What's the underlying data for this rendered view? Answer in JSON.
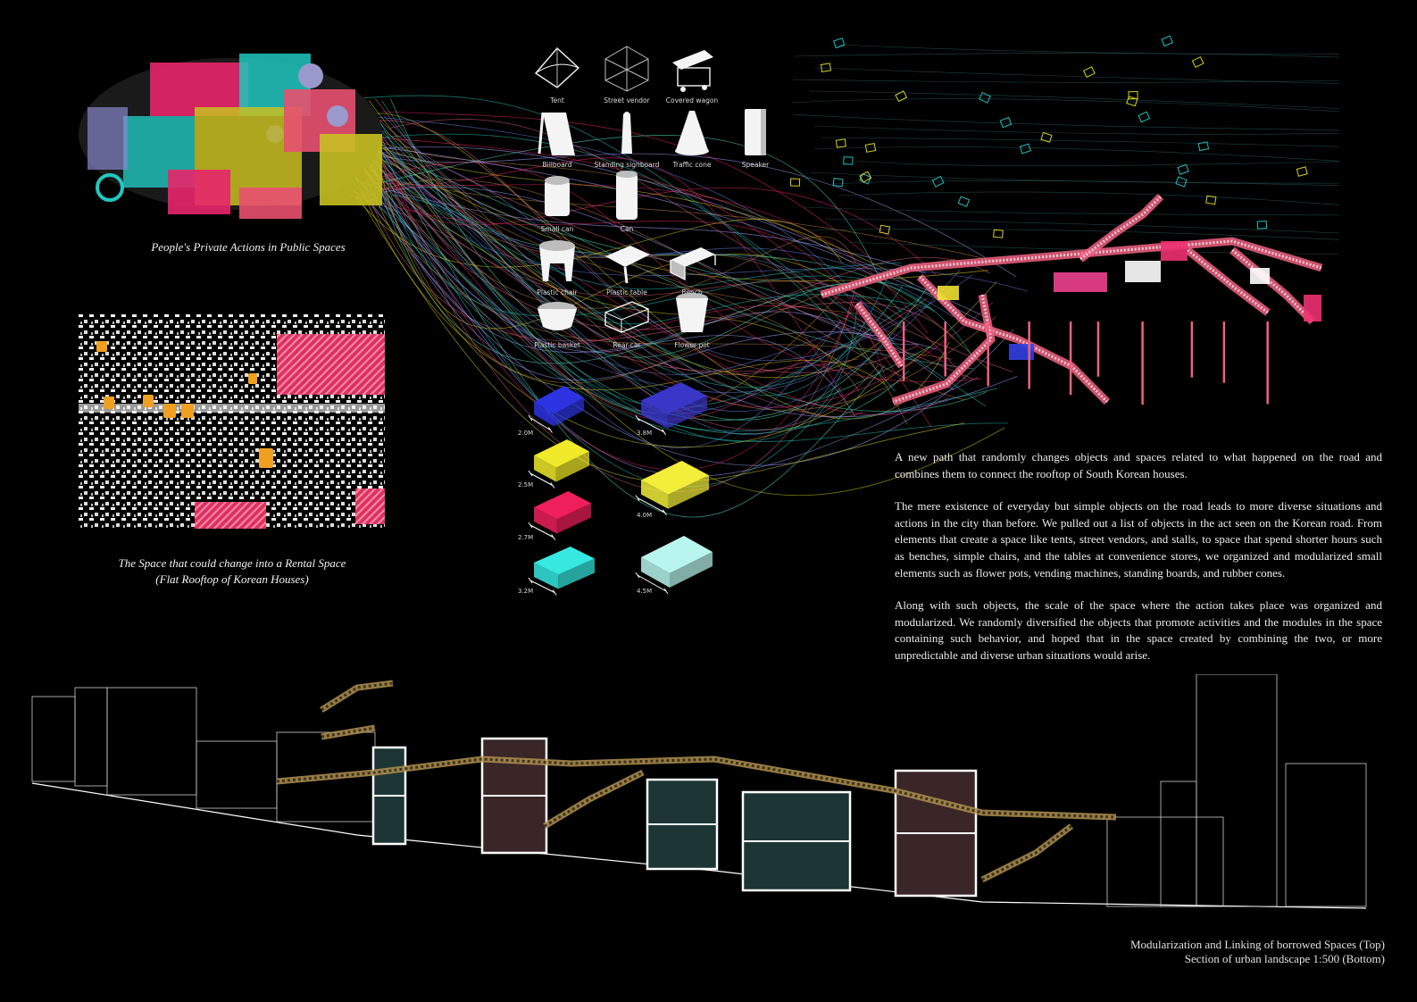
{
  "captions": {
    "people": "People's Private Actions in Public Spaces",
    "rooftop_line1": "The Space that could change into a Rental Space",
    "rooftop_line2": "(Flat Rooftop of Korean Houses)"
  },
  "objects": [
    {
      "label": "Tent",
      "icon": "tent-icon"
    },
    {
      "label": "Street vendor",
      "icon": "street-vendor-icon"
    },
    {
      "label": "Covered wagon",
      "icon": "covered-wagon-icon"
    },
    {
      "label": "Billboard",
      "icon": "billboard-icon"
    },
    {
      "label": "Standing signboard",
      "icon": "standing-signboard-icon"
    },
    {
      "label": "Traffic cone",
      "icon": "traffic-cone-icon"
    },
    {
      "label": "Speaker",
      "icon": "speaker-icon"
    },
    {
      "label": "Small can",
      "icon": "small-can-icon"
    },
    {
      "label": "Can",
      "icon": "can-icon"
    },
    {
      "label": "Plastic chair",
      "icon": "plastic-chair-icon"
    },
    {
      "label": "Plastic table",
      "icon": "plastic-table-icon"
    },
    {
      "label": "Bench",
      "icon": "bench-icon"
    },
    {
      "label": "Plastic basket",
      "icon": "plastic-basket-icon"
    },
    {
      "label": "Rear-car",
      "icon": "rear-car-icon"
    },
    {
      "label": "Flower pot",
      "icon": "flower-pot-icon"
    }
  ],
  "modules": [
    {
      "size": "2.0M",
      "color": "#2b34e0"
    },
    {
      "size": "3.8M",
      "color": "#3a36c8"
    },
    {
      "size": "2.5M",
      "color": "#f0ea2a"
    },
    {
      "size": "4.0M",
      "color": "#f2ee3a"
    },
    {
      "size": "2.7M",
      "color": "#ee1f5a"
    },
    {
      "size": "3.2M",
      "color": "#36e8e0"
    },
    {
      "size": "4.5M",
      "color": "#b8f5ee"
    }
  ],
  "paragraphs": [
    "A new path that randomly changes objects and spaces related to what happened on the road and combines them to connect the rooftop of South Korean houses.",
    "The mere existence of everyday but simple objects on the road leads to more diverse situations and actions in the city than before. We pulled out a list of objects in the act seen on the Korean road. From elements that create a space like tents, street vendors, and stalls, to space that spend shorter hours such as benches, simple chairs,  and the tables at convenience stores, we organized and modularized small elements  such as flower pots, vending machines, standing boards, and rubber cones.",
    "Along with such objects, the scale of the space where the action takes place was organized and modularized. We randomly diversified the objects that promote activities and the modules in the space  containing such behavior, and hoped that in the space created by combining the two, or more unpredictable and diverse urban situations would arise."
  ],
  "bottom_caption": {
    "line1": "Modularization and Linking of borrowed Spaces (Top)",
    "line2": "Section of urban landscape 1:500 (Bottom)"
  },
  "colors": {
    "magenta": "#e8256a",
    "cyan": "#20c8c0",
    "yellow": "#d8d020",
    "pink": "#f06080",
    "section_gold": "#b09050",
    "rooftop_tank": "#f0a020"
  }
}
